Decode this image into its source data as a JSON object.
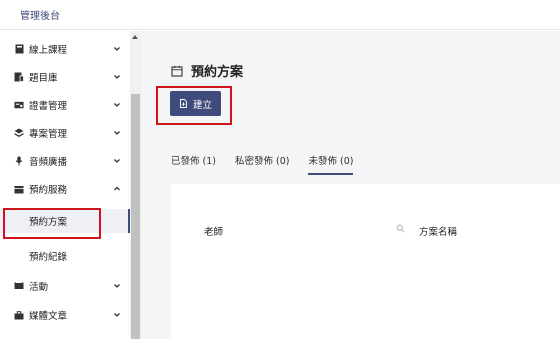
{
  "header": {
    "title": "管理後台"
  },
  "sidebar": {
    "items": [
      {
        "label": "線上課程",
        "icon": "book-icon"
      },
      {
        "label": "題目庫",
        "icon": "question-bank-icon"
      },
      {
        "label": "證書管理",
        "icon": "certificate-icon"
      },
      {
        "label": "專案管理",
        "icon": "layers-icon"
      },
      {
        "label": "音頻廣播",
        "icon": "microphone-icon"
      },
      {
        "label": "預約服務",
        "icon": "calendar-icon"
      },
      {
        "label": "預約方案",
        "sub": true,
        "active": true
      },
      {
        "label": "預約紀錄",
        "sub": true
      },
      {
        "label": "活動",
        "icon": "ticket-icon"
      },
      {
        "label": "媒體文章",
        "icon": "briefcase-icon"
      }
    ]
  },
  "main": {
    "title": "預約方案",
    "create_label": "建立",
    "tabs": [
      {
        "label": "已發佈 (1)"
      },
      {
        "label": "私密發佈 (0)"
      },
      {
        "label": "未發佈 (0)",
        "active": true
      }
    ],
    "table": {
      "col_teacher": "老師",
      "col_plan_name": "方案名稱"
    }
  },
  "colors": {
    "brand": "#3f4b7a",
    "highlight": "#d0141e"
  }
}
